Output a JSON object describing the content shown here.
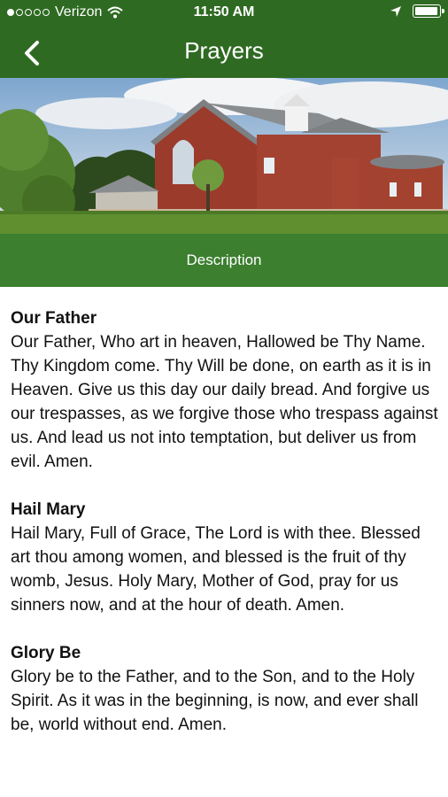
{
  "status_bar": {
    "carrier": "Verizon",
    "time": "11:50 AM",
    "signal_level": 1,
    "battery_level": 0.95
  },
  "nav": {
    "title": "Prayers",
    "back_icon": "chevron-left-icon"
  },
  "description_tab": {
    "label": "Description"
  },
  "prayers": [
    {
      "title": "Our Father",
      "text": "Our Father, Who art in heaven, Hallowed be Thy Name. Thy Kingdom come. Thy Will be done, on earth as it is in Heaven. Give us this day our daily bread. And forgive us our trespasses, as we forgive those who trespass against us. And lead us not into temptation, but deliver us from evil. Amen."
    },
    {
      "title": "Hail Mary",
      "text": "Hail Mary, Full of Grace, The Lord is with thee. Blessed art thou among women, and blessed is the fruit of thy womb, Jesus. Holy Mary, Mother of God, pray for us sinners now, and at the hour of death. Amen."
    },
    {
      "title": "Glory Be",
      "text": "Glory be to the Father, and to the Son, and to the Holy Spirit. As it was in the beginning, is now, and ever shall be, world without end. Amen."
    }
  ],
  "colors": {
    "header": "#2f6a22",
    "description_bar": "#3c7f2f"
  }
}
